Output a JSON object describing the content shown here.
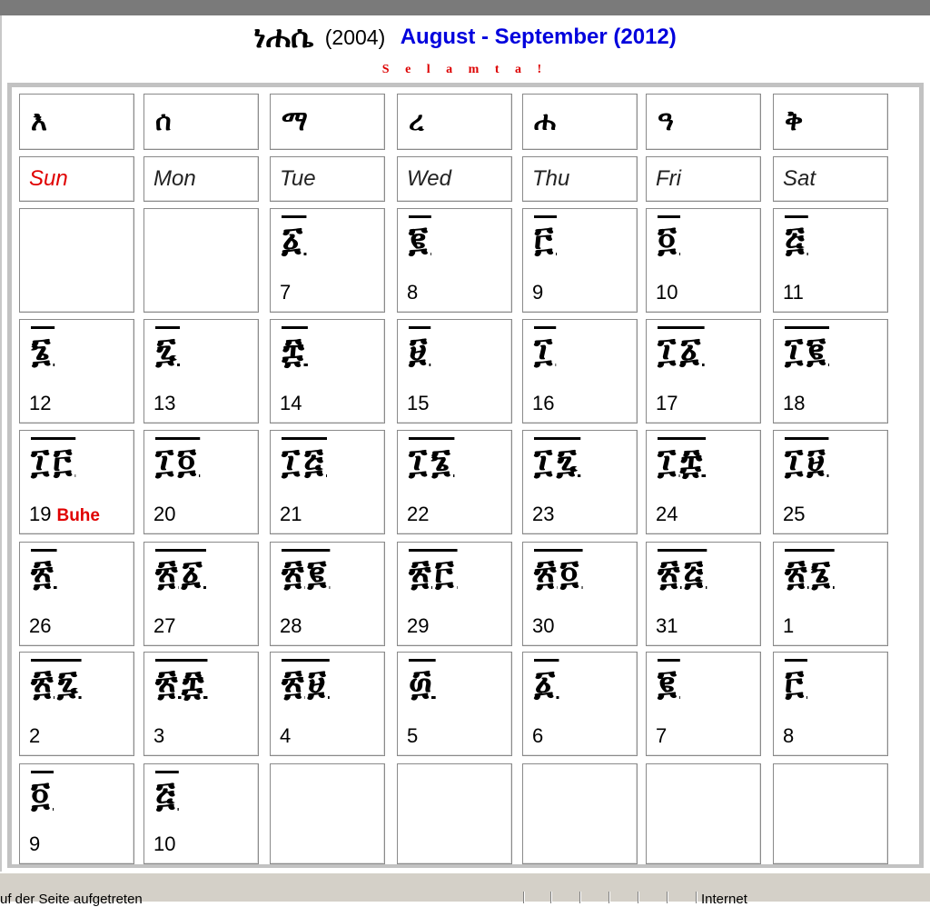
{
  "header": {
    "eth_month": "ነሐሴ",
    "eth_year": "(2004)",
    "greg_months": "August - September (2012)",
    "greeting": "S e l a m t a !"
  },
  "weekdays": [
    {
      "eth": "እ",
      "name": "Sun"
    },
    {
      "eth": "ሰ",
      "name": "Mon"
    },
    {
      "eth": "ማ",
      "name": "Tue"
    },
    {
      "eth": "ረ",
      "name": "Wed"
    },
    {
      "eth": "ሐ",
      "name": "Thu"
    },
    {
      "eth": "ዓ",
      "name": "Fri"
    },
    {
      "eth": "ቅ",
      "name": "Sat"
    }
  ],
  "weeks": [
    [
      null,
      null,
      {
        "geez": "፩",
        "g": "7"
      },
      {
        "geez": "፪",
        "g": "8"
      },
      {
        "geez": "፫",
        "g": "9"
      },
      {
        "geez": "፬",
        "g": "10"
      },
      {
        "geez": "፭",
        "g": "11"
      }
    ],
    [
      {
        "geez": "፮",
        "g": "12"
      },
      {
        "geez": "፯",
        "g": "13"
      },
      {
        "geez": "፰",
        "g": "14"
      },
      {
        "geez": "፱",
        "g": "15"
      },
      {
        "geez": "፲",
        "g": "16"
      },
      {
        "geez": "፲፩",
        "g": "17"
      },
      {
        "geez": "፲፪",
        "g": "18"
      }
    ],
    [
      {
        "geez": "፲፫",
        "g": "19",
        "holiday": "Buhe"
      },
      {
        "geez": "፲፬",
        "g": "20"
      },
      {
        "geez": "፲፭",
        "g": "21"
      },
      {
        "geez": "፲፮",
        "g": "22"
      },
      {
        "geez": "፲፯",
        "g": "23"
      },
      {
        "geez": "፲፰",
        "g": "24"
      },
      {
        "geez": "፲፱",
        "g": "25"
      }
    ],
    [
      {
        "geez": "፳",
        "g": "26"
      },
      {
        "geez": "፳፩",
        "g": "27"
      },
      {
        "geez": "፳፪",
        "g": "28"
      },
      {
        "geez": "፳፫",
        "g": "29"
      },
      {
        "geez": "፳፬",
        "g": "30"
      },
      {
        "geez": "፳፭",
        "g": "31"
      },
      {
        "geez": "፳፮",
        "g": "1"
      }
    ],
    [
      {
        "geez": "፳፯",
        "g": "2"
      },
      {
        "geez": "፳፰",
        "g": "3"
      },
      {
        "geez": "፳፱",
        "g": "4"
      },
      {
        "geez": "፴",
        "g": "5"
      },
      {
        "geez": "፩",
        "g": "6"
      },
      {
        "geez": "፪",
        "g": "7"
      },
      {
        "geez": "፫",
        "g": "8"
      }
    ],
    [
      {
        "geez": "፬",
        "g": "9"
      },
      {
        "geez": "፭",
        "g": "10"
      },
      null,
      null,
      null,
      null,
      null
    ]
  ],
  "status": {
    "text": "uf der Seite aufgetreten",
    "zone": "Internet"
  },
  "colors": {
    "sunday": "#e00000",
    "gregorian": "#0000dd",
    "greeting": "#dd0000"
  }
}
